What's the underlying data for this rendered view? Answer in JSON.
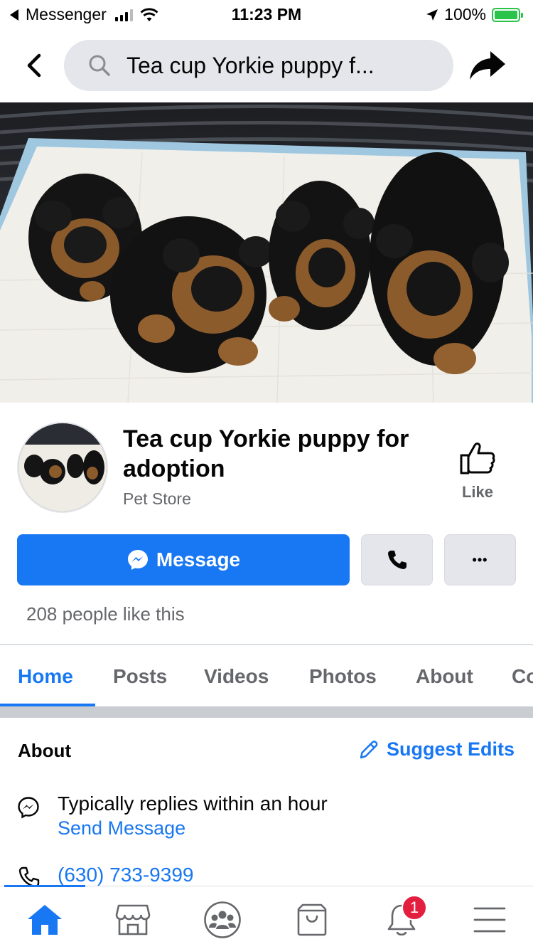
{
  "status_bar": {
    "back_app": "Messenger",
    "time": "11:23 PM",
    "battery": "100%"
  },
  "nav": {
    "search_text": "Tea cup Yorkie puppy f..."
  },
  "page": {
    "title": "Tea cup Yorkie puppy for adoption",
    "category": "Pet Store",
    "like_label": "Like",
    "message_label": "Message",
    "more_label": "•••",
    "likes_count": "208 people like this"
  },
  "tabs": [
    {
      "label": "Home",
      "active": true
    },
    {
      "label": "Posts"
    },
    {
      "label": "Videos"
    },
    {
      "label": "Photos"
    },
    {
      "label": "About"
    },
    {
      "label": "Co"
    }
  ],
  "about": {
    "heading": "About",
    "suggest_edits": "Suggest Edits",
    "reply_time": "Typically replies within an hour",
    "send_message": "Send Message",
    "phone": "(630) 733-9399"
  },
  "bottom_nav": {
    "items": [
      "home-icon",
      "marketplace-icon",
      "groups-icon",
      "shop-icon",
      "notifications-icon",
      "menu-icon"
    ],
    "notifications_badge": "1"
  },
  "colors": {
    "accent": "#1877f2",
    "badge": "#e41e3f",
    "battery": "#2cc34a"
  }
}
